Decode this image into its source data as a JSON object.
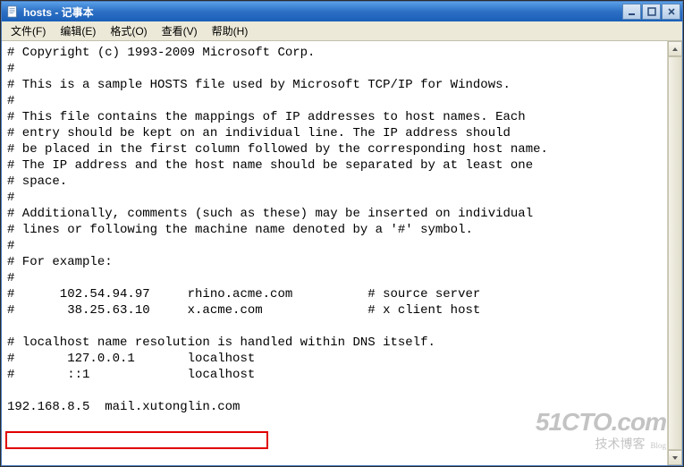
{
  "titlebar": {
    "title": "hosts - 记事本"
  },
  "menu": {
    "file": "文件(F)",
    "edit": "编辑(E)",
    "format": "格式(O)",
    "view": "查看(V)",
    "help": "帮助(H)"
  },
  "editor": {
    "content": "# Copyright (c) 1993-2009 Microsoft Corp.\n#\n# This is a sample HOSTS file used by Microsoft TCP/IP for Windows.\n#\n# This file contains the mappings of IP addresses to host names. Each\n# entry should be kept on an individual line. The IP address should\n# be placed in the first column followed by the corresponding host name.\n# The IP address and the host name should be separated by at least one\n# space.\n#\n# Additionally, comments (such as these) may be inserted on individual\n# lines or following the machine name denoted by a '#' symbol.\n#\n# For example:\n#\n#      102.54.94.97     rhino.acme.com          # source server\n#       38.25.63.10     x.acme.com              # x client host\n\n# localhost name resolution is handled within DNS itself.\n#\t127.0.0.1       localhost\n#\t::1             localhost\n\n192.168.8.5  mail.xutonglin.com"
  },
  "watermark": {
    "main": "51CTO.com",
    "sub": "技术博客",
    "blog": "Blog"
  }
}
